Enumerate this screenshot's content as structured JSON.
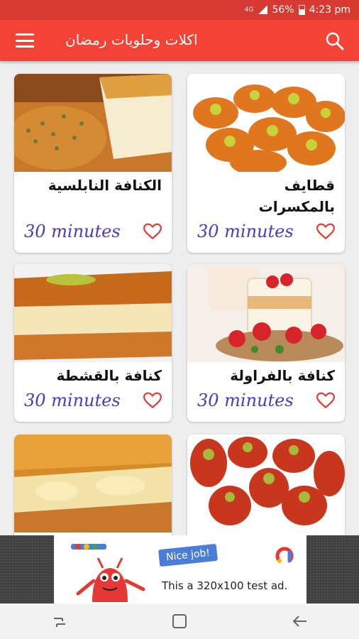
{
  "status_bar": {
    "network": "4G",
    "battery": "56%",
    "time": "4:23 pm"
  },
  "app_bar": {
    "title": "اكلات وحلويات رمضان"
  },
  "recipes": [
    {
      "title": "الكنافة النابلسية",
      "time": "30 minutes"
    },
    {
      "title": "قطايف بالمكسرات",
      "time": "30 minutes"
    },
    {
      "title": "كنافة بالقشطة",
      "time": "30 minutes"
    },
    {
      "title": "كنافة بالفراولة",
      "time": "30 minutes"
    },
    {
      "title": "",
      "time": ""
    },
    {
      "title": "",
      "time": ""
    }
  ],
  "ad": {
    "badge": "Nice job!",
    "text": "This a 320x100 test ad."
  },
  "colors": {
    "primary": "#f44336",
    "status": "#d73a30",
    "accent_text": "#4a3bbf",
    "heart": "#e53935"
  }
}
